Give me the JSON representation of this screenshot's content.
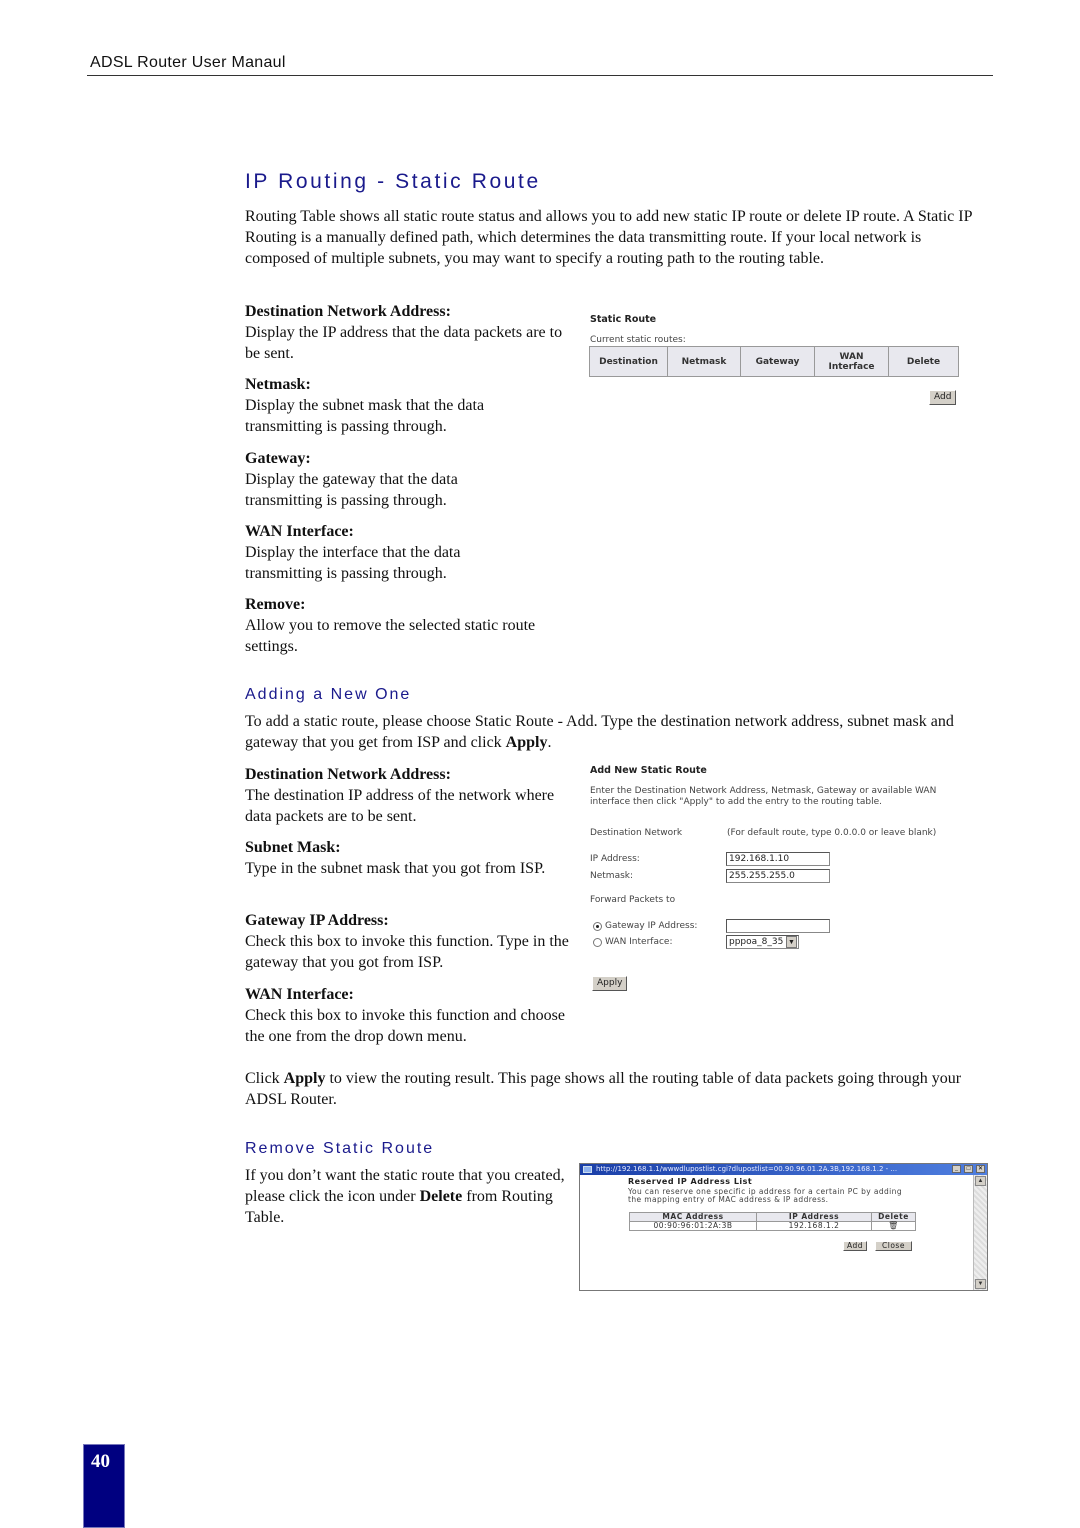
{
  "header": {
    "title": "ADSL Router User Manaul"
  },
  "section": {
    "title": "IP Routing - Static Route",
    "intro": "Routing Table shows all static route status and allows you to add new static IP route or delete IP route. A Static IP Routing is a manually defined path, which determines the data transmitting route. If your local network is composed of multiple subnets, you may want to specify a routing path to the routing table.",
    "fields": [
      {
        "label": "Destination Network Address:",
        "desc": "Display the IP address that the data packets are to be sent."
      },
      {
        "label": "Netmask:",
        "desc": "Display the subnet mask that the data transmitting is passing through."
      },
      {
        "label": "Gateway:",
        "desc": "Display the gateway that the data transmitting is passing through."
      },
      {
        "label": "WAN Interface:",
        "desc": "Display the interface that the data transmitting is passing through."
      },
      {
        "label": "Remove:",
        "desc": "Allow you to remove the selected static route settings."
      }
    ]
  },
  "static_route_screen": {
    "title": "Static Route",
    "subtitle": "Current static routes:",
    "columns": [
      "Destination",
      "Netmask",
      "Gateway",
      "WAN Interface",
      "Delete"
    ],
    "add_label": "Add"
  },
  "adding": {
    "title": "Adding a New One",
    "intro_pre": "To add a static route, please choose Static Route - Add. Type the destination network address, subnet mask and gateway that you get from ISP and click ",
    "intro_bold": "Apply",
    "intro_post": ".",
    "fields": [
      {
        "label": "Destination Network Address:",
        "desc": "The destination IP address of the network where data packets are to be sent."
      },
      {
        "label": "Subnet Mask:",
        "desc": "Type in the subnet mask that you got from ISP."
      },
      {
        "label": "Gateway IP Address:",
        "desc": "Check this box to invoke this function. Type in the gateway that you got from ISP."
      },
      {
        "label": "WAN Interface:",
        "desc": "Check this box to invoke this function and choose the one from the drop down menu."
      }
    ],
    "apply_pre": "Click ",
    "apply_bold": "Apply",
    "apply_post": " to view the routing result. This page shows all the routing table of data packets going through your ADSL Router."
  },
  "add_screen": {
    "title": "Add New Static Route",
    "instructions": "Enter the Destination Network Address, Netmask, Gateway or available WAN interface then click \"Apply\" to add the entry to the routing table.",
    "dest_label": "Destination Network",
    "dest_hint": "(For default route, type 0.0.0.0 or leave blank)",
    "ip_label": "IP Address:",
    "ip_value": "192.168.1.10",
    "netmask_label": "Netmask:",
    "netmask_value": "255.255.255.0",
    "forward_label": "Forward Packets to",
    "gateway_radio_label": "Gateway IP Address:",
    "gateway_value": "",
    "wan_radio_label": "WAN Interface:",
    "wan_selected": "pppoa_8_35",
    "selected_option": "gateway",
    "apply_label": "Apply"
  },
  "remove": {
    "title": "Remove Static Route",
    "text_pre": "If you don’t want the static route that you created, please click the icon under ",
    "text_bold": "Delete",
    "text_post": " from Routing Table."
  },
  "popup": {
    "url": "http://192.168.1.1/wwwdlupostlist.cgi?dlupostlist=00.90.96.01.2A.3B,192.168.1.2 - ...",
    "title": "Reserved IP Address List",
    "text": "You can reserve one specific ip address for a certain PC by adding the mapping entry of MAC address & IP address.",
    "columns": [
      "MAC Address",
      "IP Address",
      "Delete"
    ],
    "rows": [
      {
        "mac": "00:90:96:01:2A:3B",
        "ip": "192.168.1.2",
        "delete_icon": "trash-icon"
      }
    ],
    "add_label": "Add",
    "close_label": "Close"
  },
  "page_number": "40"
}
